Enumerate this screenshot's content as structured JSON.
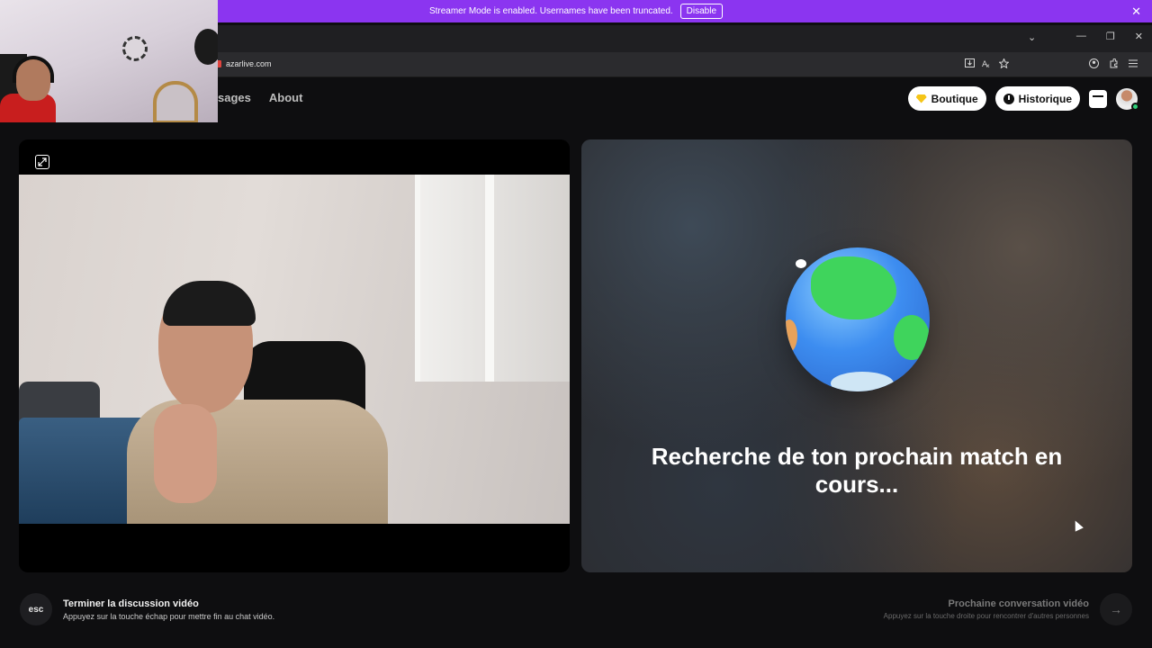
{
  "banner": {
    "message": "Streamer Mode is enabled. Usernames have been truncated.",
    "disable_label": "Disable",
    "close_glyph": "✕"
  },
  "titlebar": {
    "chevron_glyph": "⌄",
    "minimize_glyph": "—",
    "restore_glyph": "❐",
    "close_glyph": "✕"
  },
  "address": {
    "url": "azarlive.com"
  },
  "nav": {
    "messages_label": "sages",
    "about_label": "About"
  },
  "actions": {
    "boutique_label": "Boutique",
    "historique_label": "Historique"
  },
  "search": {
    "text": "Recherche de ton prochain match en cours..."
  },
  "footer": {
    "esc_key": "esc",
    "end_title": "Terminer la discussion vidéo",
    "end_sub": "Appuyez sur la touche échap pour mettre fin au chat vidéo.",
    "next_title": "Prochaine conversation vidéo",
    "next_sub": "Appuyez sur la touche droite pour rencontrer d'autres personnes",
    "next_glyph": "→"
  },
  "colors": {
    "banner": "#8b35f0",
    "background": "#0e0e10",
    "online": "#2fd07a"
  }
}
